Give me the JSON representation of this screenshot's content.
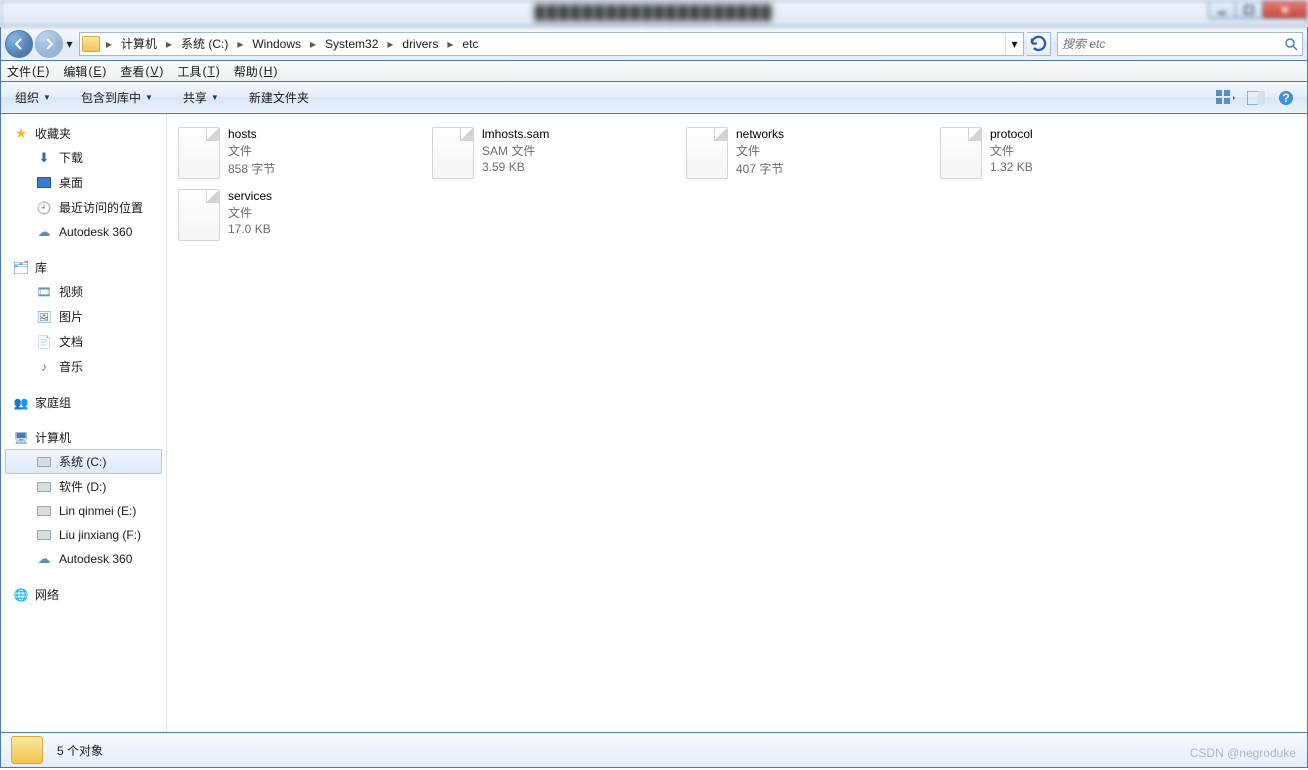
{
  "title_controls": {
    "min": "min",
    "max": "max",
    "close": "close"
  },
  "breadcrumbs": [
    "计算机",
    "系统 (C:)",
    "Windows",
    "System32",
    "drivers",
    "etc"
  ],
  "search": {
    "placeholder": "搜索 etc"
  },
  "menubar": [
    {
      "label": "文件",
      "accel": "F"
    },
    {
      "label": "编辑",
      "accel": "E"
    },
    {
      "label": "查看",
      "accel": "V"
    },
    {
      "label": "工具",
      "accel": "T"
    },
    {
      "label": "帮助",
      "accel": "H"
    }
  ],
  "toolbar": {
    "organize": "组织",
    "include": "包含到库中",
    "share": "共享",
    "newfolder": "新建文件夹"
  },
  "sidebar": {
    "favorites": {
      "header": "收藏夹",
      "items": [
        "下载",
        "桌面",
        "最近访问的位置",
        "Autodesk 360"
      ]
    },
    "libraries": {
      "header": "库",
      "items": [
        "视频",
        "图片",
        "文档",
        "音乐"
      ]
    },
    "homegroup": {
      "header": "家庭组"
    },
    "computer": {
      "header": "计算机",
      "items": [
        "系统 (C:)",
        "软件 (D:)",
        "Lin qinmei (E:)",
        "Liu jinxiang (F:)",
        "Autodesk 360"
      ]
    },
    "network": {
      "header": "网络"
    }
  },
  "files": [
    {
      "name": "hosts",
      "type": "文件",
      "size": "858 字节"
    },
    {
      "name": "lmhosts.sam",
      "type": "SAM 文件",
      "size": "3.59 KB"
    },
    {
      "name": "networks",
      "type": "文件",
      "size": "407 字节"
    },
    {
      "name": "protocol",
      "type": "文件",
      "size": "1.32 KB"
    },
    {
      "name": "services",
      "type": "文件",
      "size": "17.0 KB"
    }
  ],
  "status": {
    "count": "5 个对象"
  },
  "watermark": "CSDN @negroduke"
}
